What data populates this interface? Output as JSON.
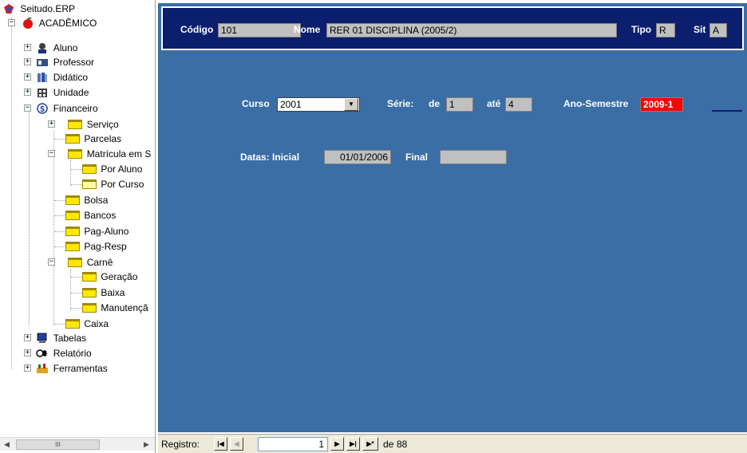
{
  "tree": {
    "root": "Seitudo.ERP",
    "academico": "ACADÊMICO",
    "nodes": {
      "aluno": "Aluno",
      "professor": "Professor",
      "didatico": "Didático",
      "unidade": "Unidade",
      "financeiro": "Financeiro",
      "servico": "Serviço",
      "parcelas": "Parcelas",
      "matricula": "Matrícula em S",
      "por_aluno": "Por Aluno",
      "por_curso": "Por Curso",
      "bolsa": "Bolsa",
      "bancos": "Bancos",
      "pag_aluno": "Pag-Aluno",
      "pag_resp": "Pag-Resp",
      "carne": "Carnê",
      "geracao": "Geração",
      "baixa": "Baixa",
      "manutencao": "Manutençã",
      "caixa": "Caixa",
      "tabelas": "Tabelas",
      "relatorio": "Relatório",
      "ferramentas": "Ferramentas"
    },
    "expander_plus": "+",
    "expander_minus": "−",
    "scroll_thumb": "III"
  },
  "header": {
    "codigo_label": "Código",
    "codigo_value": "101",
    "nome_label": "Nome",
    "nome_value": "RER 01 DISCIPLINA (2005/2)",
    "tipo_label": "Tipo",
    "tipo_value": "R",
    "sit_label": "Sit",
    "sit_value": "A"
  },
  "form": {
    "curso_label": "Curso",
    "curso_value": "2001",
    "serie_label": "Série:",
    "de_label": "de",
    "de_value": "1",
    "ate_label": "até",
    "ate_value": "4",
    "ano_semestre_label": "Ano-Semestre",
    "ano_semestre_value": "2009-1",
    "datas_label": "Datas: Inicial",
    "inicial_value": "01/01/2006",
    "final_label": "Final",
    "final_value": ""
  },
  "navigator": {
    "registro_label": "Registro:",
    "current": "1",
    "of_label": "de",
    "total": "88",
    "first_glyph": "|◀",
    "prev_glyph": "◀",
    "next_glyph": "▶",
    "last_glyph": "▶|",
    "new_glyph": "▶*"
  },
  "colors": {
    "form_bg": "#3a6ea5",
    "header_bg": "#0b1f6e",
    "field_bg": "#c0c0c0",
    "highlight": "#ff0000",
    "folder": "#ffe800"
  }
}
